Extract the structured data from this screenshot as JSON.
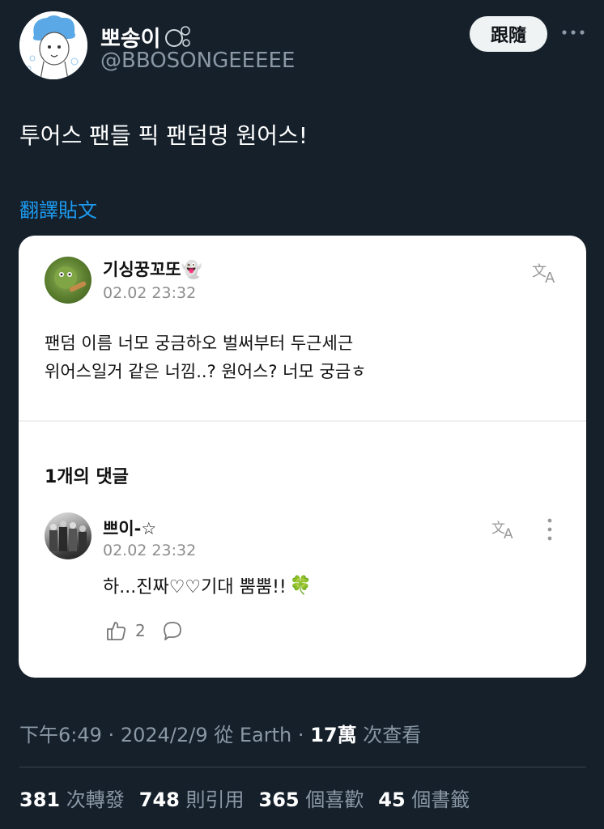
{
  "author": {
    "display_name": "뽀송이",
    "handle": "@BBOSONGEEEEE",
    "follow_label": "跟隨",
    "more_icon": "more-horizontal-icon"
  },
  "tweet": {
    "text": "투어스 팬들 픽 팬덤명 원어스!",
    "translate_label": "翻譯貼文"
  },
  "card": {
    "name": "기싱꿍꼬또👻",
    "time": "02.02 23:32",
    "body_line1": "팬덤 이름 너모 궁금하오 벌써부터 두근세근",
    "body_line2": "위어스일거 같은 너낌..? 원어스? 너모 궁금ㅎ",
    "comment_count_label": "1개의 댓글",
    "comment": {
      "name": "쁘이-☆",
      "time": "02.02 23:32",
      "text": "하...진짜♡♡기대 뿜뿜!!",
      "emoji": "🍀",
      "like_count": "2"
    }
  },
  "meta": {
    "time": "下午6:49",
    "date": "2024/2/9",
    "source": "從 Earth",
    "views_value": "17萬",
    "views_label": "次查看",
    "separator": "·"
  },
  "stats": [
    {
      "value": "381",
      "label": "次轉發"
    },
    {
      "value": "748",
      "label": "則引用"
    },
    {
      "value": "365",
      "label": "個喜歡"
    },
    {
      "value": "45",
      "label": "個書籤"
    }
  ],
  "colors": {
    "background": "#15202b",
    "accent": "#1d9bf0",
    "muted": "#8b98a5"
  }
}
